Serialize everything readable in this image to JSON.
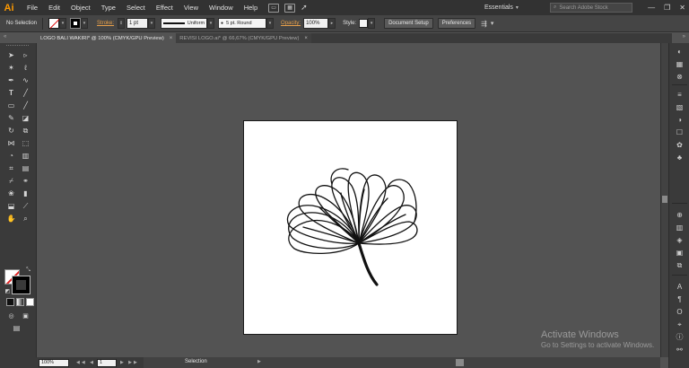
{
  "app": {
    "logo": "Ai",
    "menu": [
      "File",
      "Edit",
      "Object",
      "Type",
      "Select",
      "Effect",
      "View",
      "Window",
      "Help"
    ],
    "workspace": "Essentials",
    "search_placeholder": "Search Adobe Stock"
  },
  "control_bar": {
    "selection": "No Selection",
    "stroke_label": "Stroke:",
    "stroke_weight": "1 pt",
    "variable_width": "Uniform",
    "brush": "5 pt. Round",
    "opacity_label": "Opacity:",
    "opacity": "100%",
    "style_label": "Style:",
    "document_setup": "Document Setup",
    "preferences": "Preferences"
  },
  "tabs": [
    {
      "label": "LOGO BALI WAKIRI* @ 100% (CMYK/GPU Preview)",
      "active": true
    },
    {
      "label": "REVISI LOGO.ai* @ 66,67% (CMYK/GPU Preview)",
      "active": false
    }
  ],
  "status_bar": {
    "zoom": "100%",
    "page": "1",
    "tool": "Selection"
  },
  "watermark": {
    "title": "Activate Windows",
    "subtitle": "Go to Settings to activate Windows."
  },
  "colors": {
    "accent_orange": "#ff9a00",
    "ui_dark": "#323232",
    "ui_mid": "#454545",
    "canvas_bg": "#535353",
    "artboard": "#ffffff"
  }
}
